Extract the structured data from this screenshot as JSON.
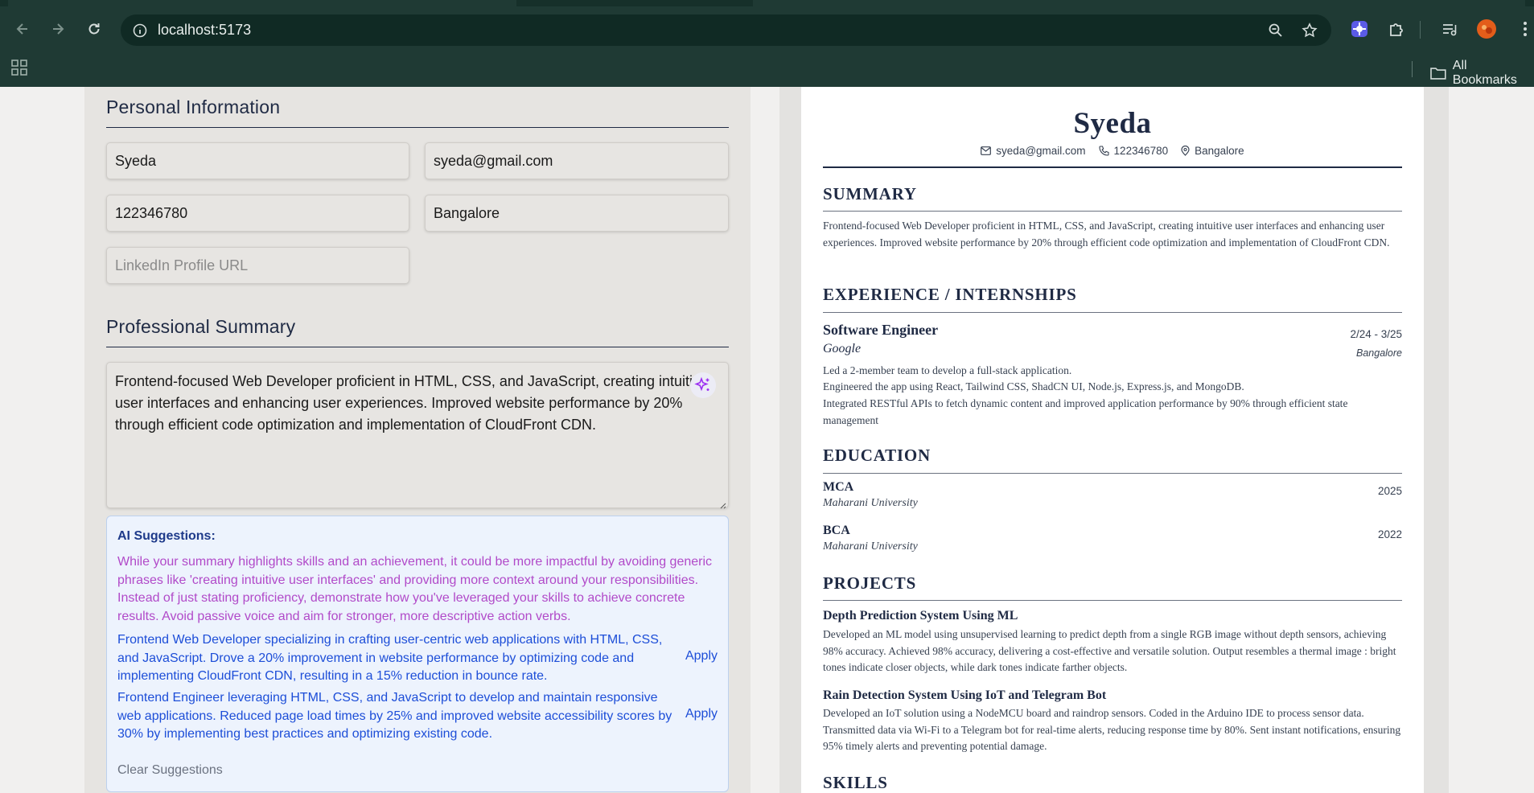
{
  "browser": {
    "url": "localhost:5173",
    "bookmarks_label": "All Bookmarks"
  },
  "form": {
    "personal_title": "Personal Information",
    "name_value": "Syeda",
    "email_value": "syeda@gmail.com",
    "phone_value": "122346780",
    "location_value": "Bangalore",
    "linkedin_placeholder": "LinkedIn Profile URL",
    "summary_title": "Professional Summary",
    "summary_value": "Frontend-focused Web Developer proficient in HTML, CSS, and JavaScript, creating intuitive user interfaces and enhancing user experiences. Improved website performance by 20% through efficient code optimization and implementation of CloudFront CDN."
  },
  "ai": {
    "title": "AI Suggestions:",
    "feedback": "While your summary highlights skills and an achievement, it could be more impactful by avoiding generic phrases like 'creating intuitive user interfaces' and providing more context around your responsibilities. Instead of just stating proficiency, demonstrate how you've leveraged your skills to achieve concrete results. Avoid passive voice and aim for stronger, more descriptive action verbs.",
    "suggestions": [
      {
        "text": "Frontend Web Developer specializing in crafting user-centric web applications with HTML, CSS, and JavaScript. Drove a 20% improvement in website performance by optimizing code and implementing CloudFront CDN, resulting in a 15% reduction in bounce rate.",
        "apply": "Apply"
      },
      {
        "text": "Frontend Engineer leveraging HTML, CSS, and JavaScript to develop and maintain responsive web applications. Reduced page load times by 25% and improved website accessibility scores by 30% by implementing best practices and optimizing existing code.",
        "apply": "Apply"
      }
    ],
    "clear": "Clear Suggestions"
  },
  "resume": {
    "name": "Syeda",
    "email": "syeda@gmail.com",
    "phone": "122346780",
    "location": "Bangalore",
    "summary_heading": "SUMMARY",
    "summary": "Frontend-focused Web Developer proficient in HTML, CSS, and JavaScript, creating intuitive user interfaces and enhancing user experiences. Improved website performance by 20% through efficient code optimization and implementation of CloudFront CDN.",
    "experience_heading": "EXPERIENCE / INTERNSHIPS",
    "experience": {
      "role": "Software Engineer",
      "dates": "2/24 - 3/25",
      "company": "Google",
      "location": "Bangalore",
      "bullets": [
        "Led a 2-member team to develop a full-stack application.",
        "Engineered the app using React, Tailwind CSS, ShadCN UI, Node.js, Express.js, and MongoDB.",
        "Integrated RESTful APIs to fetch dynamic content and improved application performance by 90% through efficient state management"
      ]
    },
    "education_heading": "EDUCATION",
    "education": [
      {
        "degree": "MCA",
        "school": "Maharani University",
        "year": "2025"
      },
      {
        "degree": "BCA",
        "school": "Maharani University",
        "year": "2022"
      }
    ],
    "projects_heading": "PROJECTS",
    "projects": [
      {
        "title": "Depth Prediction System Using ML",
        "desc": "Developed an ML model using unsupervised learning to predict depth from a single RGB image without depth sensors, achieving 98% accuracy. Achieved 98% accuracy, delivering a cost-effective and versatile solution. Output resembles a thermal image : bright tones indicate closer objects, while dark tones indicate farther objects."
      },
      {
        "title": "Rain Detection System Using IoT and Telegram Bot",
        "desc": "Developed an IoT solution using a NodeMCU board and raindrop sensors. Coded in the Arduino IDE to process sensor data. Transmitted data via Wi-Fi to a Telegram bot for real-time alerts, reducing response time by 80%. Sent instant notifications, ensuring 95% timely alerts and preventing potential damage."
      }
    ],
    "skills_heading": "SKILLS"
  }
}
